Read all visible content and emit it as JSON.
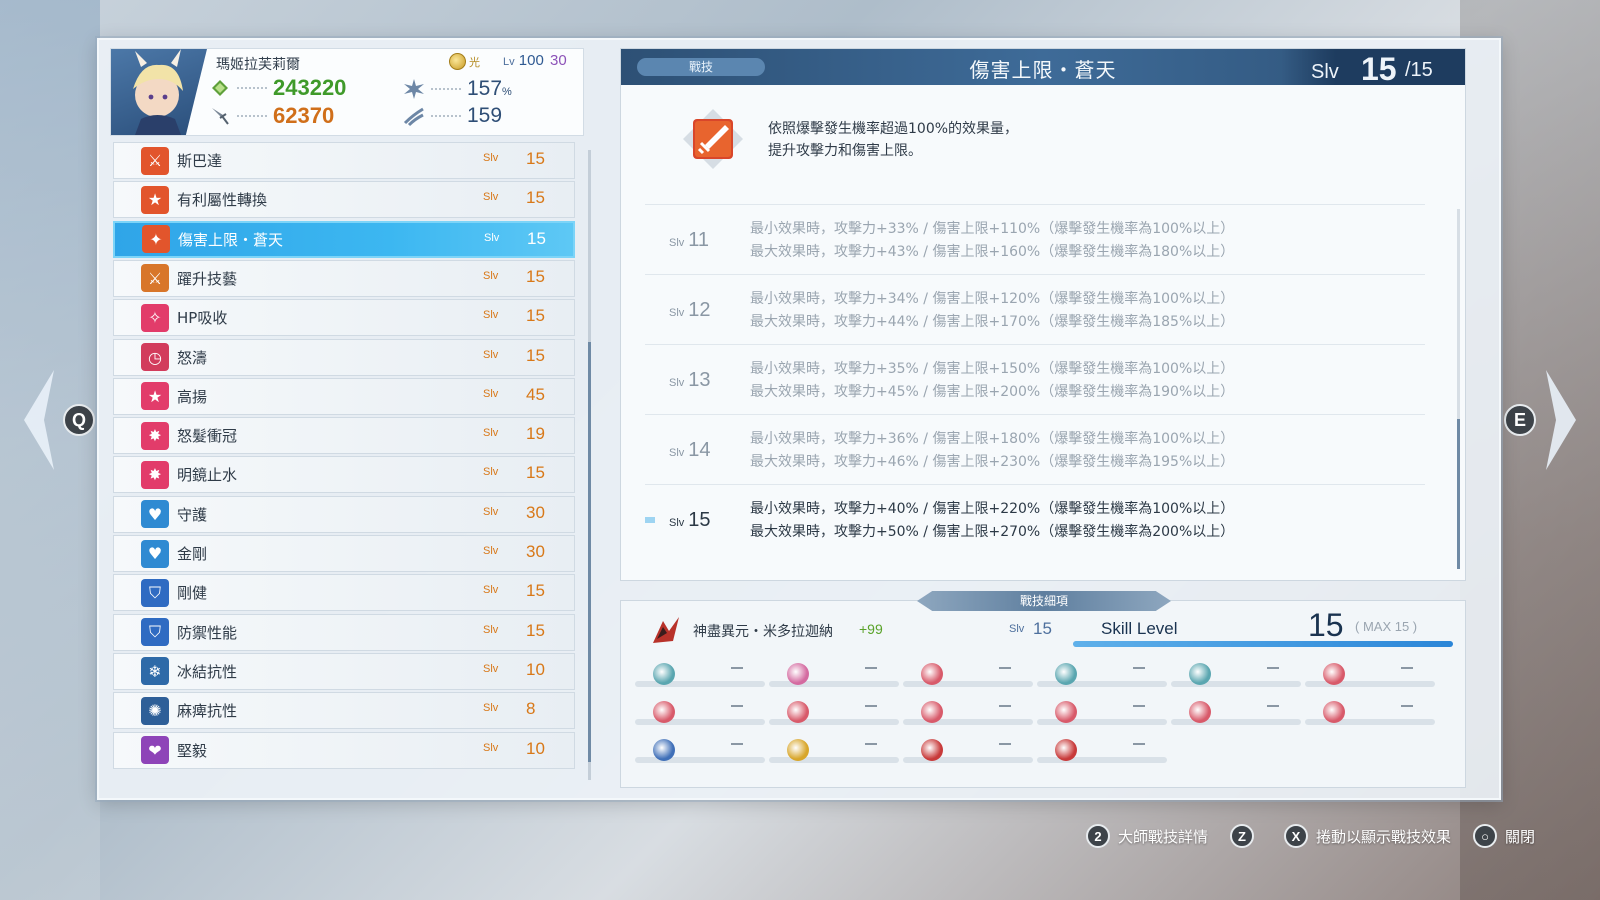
{
  "character": {
    "name": "瑪姬拉芙莉爾",
    "element_label": "光",
    "level_label": "Lv",
    "level": "100",
    "level_plus": "30",
    "hp": "243220",
    "atk": "62370",
    "crit_rate": "157",
    "crit_unit": "%",
    "crit_stat": "159"
  },
  "skills": [
    {
      "name": "斯巴達",
      "slv_label": "Slv",
      "slv": "15",
      "icon": "sword-icon",
      "color": "#e2552c"
    },
    {
      "name": "有利屬性轉換",
      "slv_label": "Slv",
      "slv": "15",
      "icon": "star-icon",
      "color": "#e2552c"
    },
    {
      "name": "傷害上限・蒼天",
      "slv_label": "Slv",
      "slv": "15",
      "icon": "sword-break-icon",
      "color": "#e2552c"
    },
    {
      "name": "躍升技藝",
      "slv_label": "Slv",
      "slv": "15",
      "icon": "crossed-swords-icon",
      "color": "#d8762a"
    },
    {
      "name": "HP吸收",
      "slv_label": "Slv",
      "slv": "15",
      "icon": "sparkle-icon",
      "color": "#e23c6a"
    },
    {
      "name": "怒濤",
      "slv_label": "Slv",
      "slv": "15",
      "icon": "clock-icon",
      "color": "#d23c5c"
    },
    {
      "name": "高揚",
      "slv_label": "Slv",
      "slv": "45",
      "icon": "star-icon",
      "color": "#e23c6a"
    },
    {
      "name": "怒髮衝冠",
      "slv_label": "Slv",
      "slv": "19",
      "icon": "burst-icon",
      "color": "#e23c6a"
    },
    {
      "name": "明鏡止水",
      "slv_label": "Slv",
      "slv": "15",
      "icon": "burst-icon",
      "color": "#e23c6a"
    },
    {
      "name": "守護",
      "slv_label": "Slv",
      "slv": "30",
      "icon": "heart-icon",
      "color": "#2f8ad2"
    },
    {
      "name": "金剛",
      "slv_label": "Slv",
      "slv": "30",
      "icon": "heart-icon",
      "color": "#2f8ad2"
    },
    {
      "name": "剛健",
      "slv_label": "Slv",
      "slv": "15",
      "icon": "shield-icon",
      "color": "#2f6bc2"
    },
    {
      "name": "防禦性能",
      "slv_label": "Slv",
      "slv": "15",
      "icon": "shield-icon",
      "color": "#2f6bc2"
    },
    {
      "name": "冰結抗性",
      "slv_label": "Slv",
      "slv": "10",
      "icon": "snowflake-icon",
      "color": "#2e6aa8"
    },
    {
      "name": "麻痺抗性",
      "slv_label": "Slv",
      "slv": "8",
      "icon": "paralysis-icon",
      "color": "#2e5f98"
    },
    {
      "name": "堅毅",
      "slv_label": "Slv",
      "slv": "10",
      "icon": "heart-burst-icon",
      "color": "#8e44b8"
    }
  ],
  "selected_skill_index": 2,
  "detail": {
    "category": "戰技",
    "title": "傷害上限・蒼天",
    "slv_label": "Slv",
    "slv_current": "15",
    "slv_max": "/15",
    "description_line1": "依照爆擊發生機率超過100%的效果量，",
    "description_line2": "提升攻擊力和傷害上限。",
    "levels": [
      {
        "label": "Slv",
        "num": "11",
        "line1": "最小效果時，攻擊力+33% / 傷害上限+110%（爆擊發生機率為100%以上）",
        "line2": "最大效果時，攻擊力+43% / 傷害上限+160%（爆擊發生機率為180%以上）"
      },
      {
        "label": "Slv",
        "num": "12",
        "line1": "最小效果時，攻擊力+34% / 傷害上限+120%（爆擊發生機率為100%以上）",
        "line2": "最大效果時，攻擊力+44% / 傷害上限+170%（爆擊發生機率為185%以上）"
      },
      {
        "label": "Slv",
        "num": "13",
        "line1": "最小效果時，攻擊力+35% / 傷害上限+150%（爆擊發生機率為100%以上）",
        "line2": "最大效果時，攻擊力+45% / 傷害上限+200%（爆擊發生機率為190%以上）"
      },
      {
        "label": "Slv",
        "num": "14",
        "line1": "最小效果時，攻擊力+36% / 傷害上限+180%（爆擊發生機率為100%以上）",
        "line2": "最大效果時，攻擊力+46% / 傷害上限+230%（爆擊發生機率為195%以上）"
      },
      {
        "label": "Slv",
        "num": "15",
        "line1": "最小效果時，攻擊力+40% / 傷害上限+220%（爆擊發生機率為100%以上）",
        "line2": "最大效果時，攻擊力+50% / 傷害上限+270%（爆擊發生機率為200%以上）"
      }
    ],
    "current_level_index": 4
  },
  "breakdown": {
    "tab_label": "戰技細項",
    "summon_name": "神盡異元・米多拉迦納",
    "summon_plus": "+99",
    "slv_label": "Slv",
    "slv": "15",
    "skill_level_label": "Skill Level",
    "skill_level": "15",
    "skill_level_max": "( MAX 15 )",
    "skill_level_fraction": 1.0,
    "slots": [
      {
        "gem": "blue-green-sigil-icon",
        "color": "#5aa6b0",
        "value": "－"
      },
      {
        "gem": "pink-sigil-icon",
        "color": "#d46aa0",
        "value": "－"
      },
      {
        "gem": "red-sigil-icon",
        "color": "#d85a6a",
        "value": "－"
      },
      {
        "gem": "blue-green-sigil-icon",
        "color": "#5aa6b0",
        "value": "－"
      },
      {
        "gem": "blue-green-sigil-icon",
        "color": "#5aa6b0",
        "value": "－"
      },
      {
        "gem": "red-sigil-icon",
        "color": "#d85a6a",
        "value": "－"
      },
      {
        "gem": "red-sigil-icon",
        "color": "#d85a6a",
        "value": "－"
      },
      {
        "gem": "red-sigil-icon",
        "color": "#d85a6a",
        "value": "－"
      },
      {
        "gem": "red-sigil-icon",
        "color": "#d85a6a",
        "value": "－"
      },
      {
        "gem": "red-sigil-icon",
        "color": "#d85a6a",
        "value": "－"
      },
      {
        "gem": "red-sigil-icon",
        "color": "#d85a6a",
        "value": "－"
      },
      {
        "gem": "red-sigil-icon",
        "color": "#d85a6a",
        "value": "－"
      },
      {
        "gem": "blue-orb-icon",
        "color": "#3f6fb8",
        "value": "－"
      },
      {
        "gem": "gold-orb-icon",
        "color": "#d8a62a",
        "value": "－"
      },
      {
        "gem": "red-claw-icon",
        "color": "#c83a3a",
        "value": "－"
      },
      {
        "gem": "red-claw-icon",
        "color": "#c83a3a",
        "value": "－"
      }
    ]
  },
  "nav": {
    "prev_key": "Q",
    "next_key": "E"
  },
  "hints": [
    {
      "key": "2",
      "label": "大師戰技詳情"
    },
    {
      "key": "Z",
      "label": ""
    },
    {
      "key": "X",
      "label": "捲動以顯示戰技效果"
    },
    {
      "key": "○",
      "label": "關閉"
    }
  ]
}
